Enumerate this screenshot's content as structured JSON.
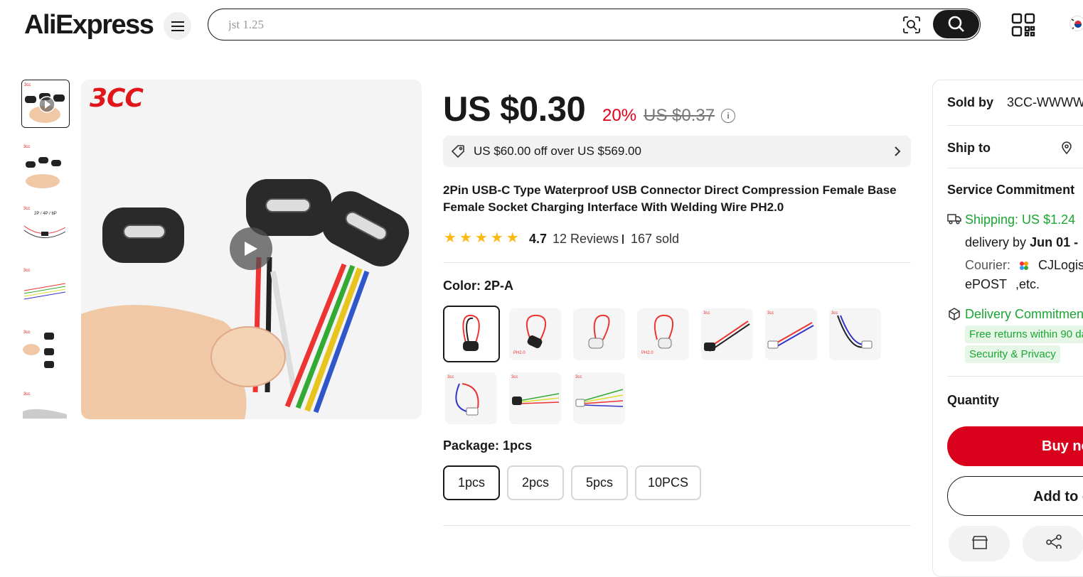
{
  "header": {
    "logo": "AliExpress",
    "search_placeholder": "jst 1.25"
  },
  "product": {
    "price": "US $0.30",
    "discount": "20%",
    "original_price": "US $0.37",
    "coupon": "US $60.00 off over US $569.00",
    "title": "2Pin USB-C Type Waterproof USB Connector Direct Compression Female Base Female Socket Charging Interface With Welding Wire PH2.0",
    "rating": "4.7",
    "reviews": "12 Reviews",
    "sold": "167 sold",
    "rating_stars": 4.7,
    "brand_mark": "3CC"
  },
  "color": {
    "label": "Color: 2P-A",
    "selected_index": 0,
    "swatch_count": 10
  },
  "package": {
    "label": "Package: 1pcs",
    "options": [
      "1pcs",
      "2pcs",
      "5pcs",
      "10PCS"
    ],
    "selected_index": 0
  },
  "seller_panel": {
    "sold_by_label": "Sold by",
    "sold_by_value": "3CC-WWWW",
    "ship_to_label": "Ship to",
    "service_label": "Service Commitment",
    "shipping": "Shipping: US $1.24",
    "delivery_prefix": "delivery by",
    "delivery_date": "Jun 01 -",
    "courier_label": "Courier:",
    "courier_name": "CJLogis",
    "courier_extra": "ePOST",
    "courier_etc": ",etc.",
    "delivery_commitment": "Delivery Commitmen",
    "free_returns": "Free returns within 90 da",
    "security": "Security & Privacy",
    "quantity_label": "Quantity",
    "buy_now": "Buy no",
    "add_to_cart": "Add to c"
  },
  "colors": {
    "accent_red": "#e1001a",
    "buy_red": "#d9001b",
    "green": "#1aa632",
    "star": "#fdb913"
  }
}
